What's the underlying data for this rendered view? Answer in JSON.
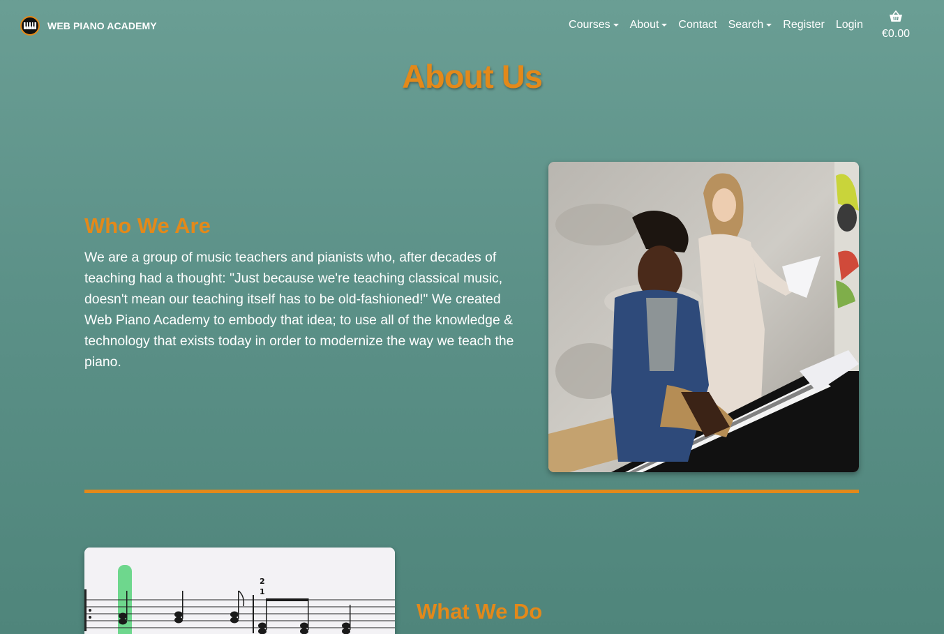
{
  "brand": {
    "name": "WEB PIANO ACADEMY",
    "logo_icon": "piano-keys-icon"
  },
  "nav": {
    "items": [
      {
        "label": "Courses",
        "dropdown": true
      },
      {
        "label": "About",
        "dropdown": true
      },
      {
        "label": "Contact",
        "dropdown": false
      },
      {
        "label": "Search",
        "dropdown": true
      },
      {
        "label": "Register",
        "dropdown": false
      },
      {
        "label": "Login",
        "dropdown": false
      }
    ],
    "cart": {
      "icon": "basket-icon",
      "total": "€0.00"
    }
  },
  "page": {
    "title": "About Us"
  },
  "who_we_are": {
    "heading": "Who We Are",
    "text": "We are a group of music teachers and pianists who, after decades of teaching had a thought: \"Just because we're teaching classical music, doesn't mean our teaching itself has to be old-fashioned!\" We created Web Piano Academy to embody that idea; to use all of the knowledge & technology that exists today in order to modernize the way we teach the piano."
  },
  "what_we_do": {
    "heading": "What We Do"
  },
  "colors": {
    "accent": "#e3891a",
    "background_top": "#6a9e94",
    "background_bottom": "#4f857b",
    "text": "#ffffff"
  }
}
